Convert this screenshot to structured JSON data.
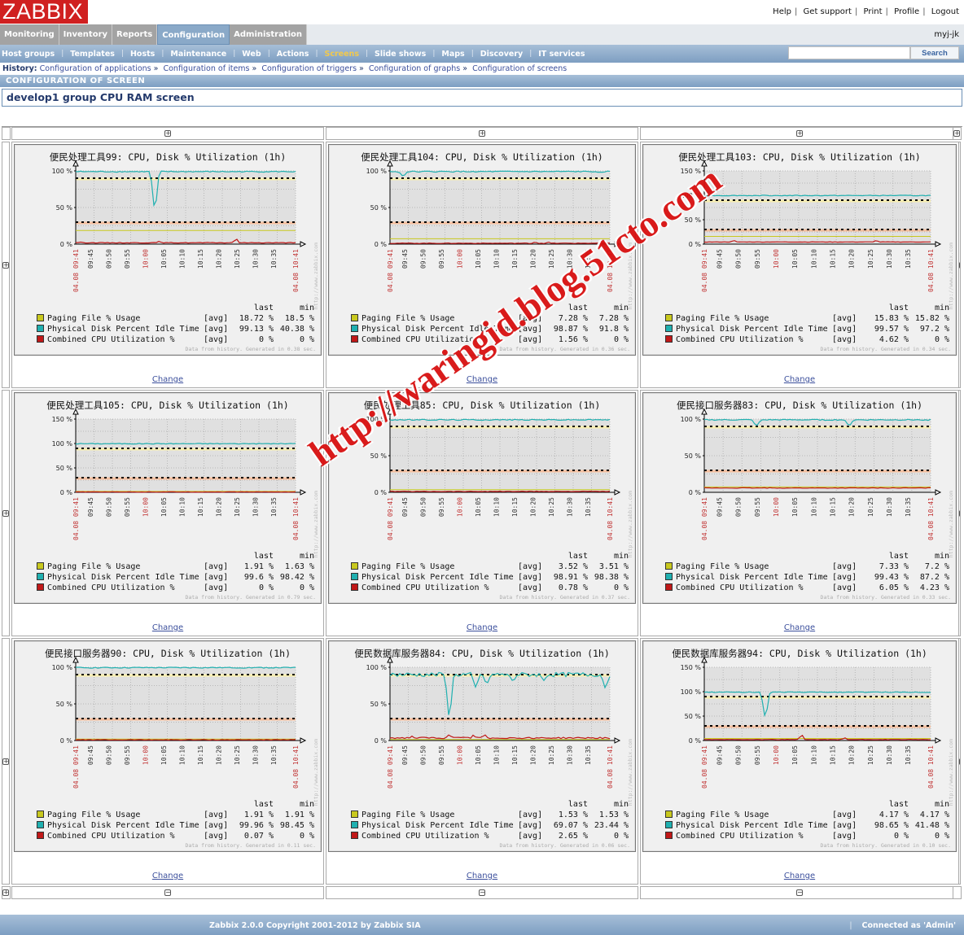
{
  "app": {
    "logo": "ZABBIX",
    "user": "myj-jk"
  },
  "toplinks": [
    "Help",
    "Get support",
    "Print",
    "Profile",
    "Logout"
  ],
  "main_menu": [
    {
      "label": "Monitoring",
      "active": false
    },
    {
      "label": "Inventory",
      "active": false
    },
    {
      "label": "Reports",
      "active": false
    },
    {
      "label": "Configuration",
      "active": true
    },
    {
      "label": "Administration",
      "active": false
    }
  ],
  "sub_menu": [
    {
      "label": "Host groups",
      "active": false
    },
    {
      "label": "Templates",
      "active": false
    },
    {
      "label": "Hosts",
      "active": false
    },
    {
      "label": "Maintenance",
      "active": false
    },
    {
      "label": "Web",
      "active": false
    },
    {
      "label": "Actions",
      "active": false
    },
    {
      "label": "Screens",
      "active": true
    },
    {
      "label": "Slide shows",
      "active": false
    },
    {
      "label": "Maps",
      "active": false
    },
    {
      "label": "Discovery",
      "active": false
    },
    {
      "label": "IT services",
      "active": false
    }
  ],
  "search": {
    "value": "",
    "button": "Search"
  },
  "history": {
    "label": "History:",
    "items": [
      "Configuration of applications",
      "Configuration of items",
      "Configuration of triggers",
      "Configuration of graphs",
      "Configuration of screens"
    ]
  },
  "section_title": "CONFIGURATION OF SCREEN",
  "screen_name": "develop1 group CPU RAM screen",
  "change_label": "Change",
  "legend_headers": {
    "last": "last",
    "min": "min",
    "agg": "[avg]"
  },
  "series_names": [
    "Paging File % Usage",
    "Physical Disk  Percent Idle Time",
    "Combined CPU Utilization %"
  ],
  "series_colors": [
    "#c8c81e",
    "#20b0b0",
    "#c01818"
  ],
  "x_labels": [
    "04.08 09:41",
    "09:45",
    "09:50",
    "09:55",
    "10:00",
    "10:05",
    "10:10",
    "10:15",
    "10:20",
    "10:25",
    "10:30",
    "10:35",
    "04.08 10:41"
  ],
  "watermark_side": "http://www.zabbix.com",
  "watermark_overlay": "http://waringid.blog.51cto.com",
  "footer": {
    "copyright": "Zabbix 2.0.0 Copyright 2001-2012 by Zabbix SIA",
    "connected": "Connected as 'Admin'"
  },
  "chart_data": [
    {
      "type": "line",
      "title": "便民处理工具99: CPU, Disk % Utilization (1h)",
      "ylim": [
        0,
        100
      ],
      "yticks": [
        "0 %",
        "50 %",
        "100 %"
      ],
      "triggers": [
        90,
        30
      ],
      "series": [
        {
          "name": "Paging File % Usage",
          "last": "18.72 %",
          "min": "18.5 %",
          "level": 18.7
        },
        {
          "name": "Physical Disk  Percent Idle Time",
          "last": "99.13 %",
          "min": "40.38 %",
          "level": 99,
          "dips": [
            [
              0.36,
              40
            ]
          ]
        },
        {
          "name": "Combined CPU Utilization %",
          "last": "0 %",
          "min": "0 %",
          "level": 1.5,
          "spikes": [
            [
              0.02,
              3
            ],
            [
              0.38,
              4
            ],
            [
              0.73,
              8
            ]
          ]
        }
      ],
      "generated": "Data from history. Generated in 0.38 sec."
    },
    {
      "type": "line",
      "title": "便民处理工具104: CPU, Disk % Utilization (1h)",
      "ylim": [
        0,
        100
      ],
      "yticks": [
        "0 %",
        "50 %",
        "100 %"
      ],
      "triggers": [
        90,
        30
      ],
      "series": [
        {
          "name": "Paging File % Usage",
          "last": "7.28 %",
          "min": "7.28 %",
          "level": 7.3
        },
        {
          "name": "Physical Disk  Percent Idle Time",
          "last": "98.87 %",
          "min": "91.8 %",
          "level": 99,
          "dips": [
            [
              0.06,
              92
            ]
          ]
        },
        {
          "name": "Combined CPU Utilization %",
          "last": "1.56 %",
          "min": "0 %",
          "level": 0.8,
          "spikes": [
            [
              0.66,
              3
            ],
            [
              0.72,
              3
            ]
          ]
        }
      ],
      "generated": "Data from history. Generated in 0.36 sec."
    },
    {
      "type": "line",
      "title": "便民处理工具103: CPU, Disk % Utilization (1h)",
      "ylim": [
        0,
        150
      ],
      "yticks": [
        "0 %",
        "50 %",
        "100 %",
        "150 %"
      ],
      "triggers": [
        90,
        30
      ],
      "series": [
        {
          "name": "Paging File % Usage",
          "last": "15.83 %",
          "min": "15.82 %",
          "level": 15.8
        },
        {
          "name": "Physical Disk  Percent Idle Time",
          "last": "99.57 %",
          "min": "97.2 %",
          "level": 99.5
        },
        {
          "name": "Combined CPU Utilization %",
          "last": "4.62 %",
          "min": "0 %",
          "level": 4,
          "spikes": [
            [
              0.13,
              8
            ],
            [
              0.76,
              8
            ]
          ]
        }
      ],
      "generated": "Data from history. Generated in 0.34 sec."
    },
    {
      "type": "line",
      "title": "便民处理工具105: CPU, Disk % Utilization (1h)",
      "ylim": [
        0,
        150
      ],
      "yticks": [
        "0 %",
        "50 %",
        "100 %",
        "150 %"
      ],
      "triggers": [
        90,
        30
      ],
      "series": [
        {
          "name": "Paging File % Usage",
          "last": "1.91 %",
          "min": "1.63 %",
          "level": 1.9
        },
        {
          "name": "Physical Disk  Percent Idle Time",
          "last": "99.6 %",
          "min": "98.42 %",
          "level": 99.6
        },
        {
          "name": "Combined CPU Utilization %",
          "last": "0 %",
          "min": "0 %",
          "level": 0.3
        }
      ],
      "generated": "Data from history. Generated in 0.79 sec."
    },
    {
      "type": "line",
      "title": "便民处理工具85: CPU, Disk % Utilization (1h)",
      "ylim": [
        0,
        100
      ],
      "yticks": [
        "0 %",
        "50 %",
        "100 %"
      ],
      "triggers": [
        90,
        30
      ],
      "series": [
        {
          "name": "Paging File % Usage",
          "last": "3.52 %",
          "min": "3.51 %",
          "level": 3.5
        },
        {
          "name": "Physical Disk  Percent Idle Time",
          "last": "98.91 %",
          "min": "98.38 %",
          "level": 99
        },
        {
          "name": "Combined CPU Utilization %",
          "last": "0.78 %",
          "min": "0 %",
          "level": 0.8
        }
      ],
      "generated": "Data from history. Generated in 0.37 sec."
    },
    {
      "type": "line",
      "title": "便民接口服务器83: CPU, Disk % Utilization (1h)",
      "ylim": [
        0,
        100
      ],
      "yticks": [
        "0 %",
        "50 %",
        "100 %"
      ],
      "triggers": [
        90,
        30
      ],
      "series": [
        {
          "name": "Paging File % Usage",
          "last": "7.33 %",
          "min": "7.2 %",
          "level": 7.3
        },
        {
          "name": "Physical Disk  Percent Idle Time",
          "last": "99.43 %",
          "min": "87.2 %",
          "level": 99,
          "dips": [
            [
              0.23,
              90
            ],
            [
              0.64,
              90
            ]
          ]
        },
        {
          "name": "Combined CPU Utilization %",
          "last": "6.05 %",
          "min": "4.23 %",
          "level": 5.5
        }
      ],
      "generated": "Data from history. Generated in 0.33 sec."
    },
    {
      "type": "line",
      "title": "便民接口服务器90: CPU, Disk % Utilization (1h)",
      "ylim": [
        0,
        100
      ],
      "yticks": [
        "0 %",
        "50 %",
        "100 %"
      ],
      "triggers": [
        90,
        30
      ],
      "series": [
        {
          "name": "Paging File % Usage",
          "last": "1.91 %",
          "min": "1.91 %",
          "level": 1.9
        },
        {
          "name": "Physical Disk  Percent Idle Time",
          "last": "99.96 %",
          "min": "98.45 %",
          "level": 99.5
        },
        {
          "name": "Combined CPU Utilization %",
          "last": "0.07 %",
          "min": "0 %",
          "level": 0.5
        }
      ],
      "generated": "Data from history. Generated in 0.11 sec."
    },
    {
      "type": "line",
      "title": "便民数据库服务器84: CPU, Disk % Utilization (1h)",
      "ylim": [
        0,
        100
      ],
      "yticks": [
        "0 %",
        "50 %",
        "100 %"
      ],
      "triggers": [
        90,
        30
      ],
      "series": [
        {
          "name": "Paging File % Usage",
          "last": "1.53 %",
          "min": "1.53 %",
          "level": 1.5
        },
        {
          "name": "Physical Disk  Percent Idle Time",
          "last": "69.07 %",
          "min": "23.44 %",
          "level": 90,
          "noisy": true,
          "dips": [
            [
              0.27,
              24
            ],
            [
              0.39,
              72
            ],
            [
              0.44,
              76
            ],
            [
              0.56,
              80
            ],
            [
              0.7,
              82
            ],
            [
              0.98,
              70
            ]
          ]
        },
        {
          "name": "Combined CPU Utilization %",
          "last": "2.65 %",
          "min": "0 %",
          "level": 2.5,
          "noisy": true,
          "spikes": [
            [
              0.1,
              6
            ],
            [
              0.27,
              9
            ],
            [
              0.38,
              8
            ],
            [
              0.43,
              9
            ]
          ]
        }
      ],
      "generated": "Data from history. Generated in 0.06 sec."
    },
    {
      "type": "line",
      "title": "便民数据库服务器94: CPU, Disk % Utilization (1h)",
      "ylim": [
        0,
        150
      ],
      "yticks": [
        "0 %",
        "50 %",
        "100 %",
        "150 %"
      ],
      "triggers": [
        90,
        30
      ],
      "series": [
        {
          "name": "Paging File % Usage",
          "last": "4.17 %",
          "min": "4.17 %",
          "level": 4.2
        },
        {
          "name": "Physical Disk  Percent Idle Time",
          "last": "98.65 %",
          "min": "41.48 %",
          "level": 99,
          "dips": [
            [
              0.27,
              42
            ]
          ]
        },
        {
          "name": "Combined CPU Utilization %",
          "last": "0 %",
          "min": "0 %",
          "level": 1.5,
          "spikes": [
            [
              0.43,
              13
            ],
            [
              0.62,
              6
            ]
          ]
        }
      ],
      "generated": "Data from history. Generated in 0.10 sec."
    }
  ]
}
